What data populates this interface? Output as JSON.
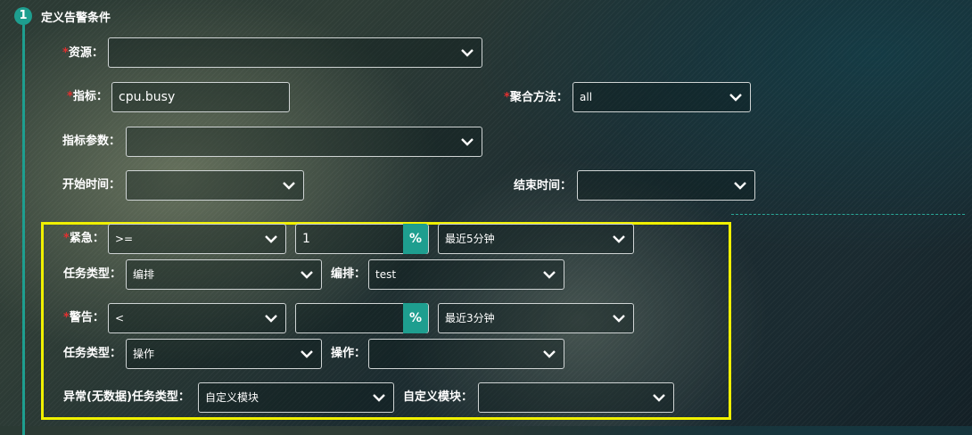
{
  "section": {
    "step": "1",
    "title": "定义告警条件"
  },
  "form": {
    "resource": {
      "label": "资源：",
      "value": ""
    },
    "metric": {
      "label": "指标：",
      "value": "cpu.busy"
    },
    "aggregation": {
      "label": "聚合方法：",
      "value": "all"
    },
    "metric_params": {
      "label": "指标参数：",
      "value": ""
    },
    "start_time": {
      "label": "开始时间：",
      "value": ""
    },
    "end_time": {
      "label": "结束时间：",
      "value": ""
    }
  },
  "urgent": {
    "label": "紧急：",
    "operator": ">=",
    "threshold": "1",
    "unit": "%",
    "window": "最近5分钟",
    "task_type_label": "任务类型：",
    "task_type": "编排",
    "task_label": "编排：",
    "task_value": "test"
  },
  "warning": {
    "label": "警告：",
    "operator": "<",
    "threshold": "",
    "unit": "%",
    "window": "最近3分钟",
    "task_type_label": "任务类型：",
    "task_type": "操作",
    "task_label": "操作：",
    "task_value": ""
  },
  "nodata": {
    "label": "异常(无数据)任务类型：",
    "task_type": "自定义模块",
    "module_label": "自定义模块：",
    "module_value": ""
  },
  "colors": {
    "accent": "#1e9e8f",
    "required": "#e03030",
    "highlight": "#f0f000"
  }
}
